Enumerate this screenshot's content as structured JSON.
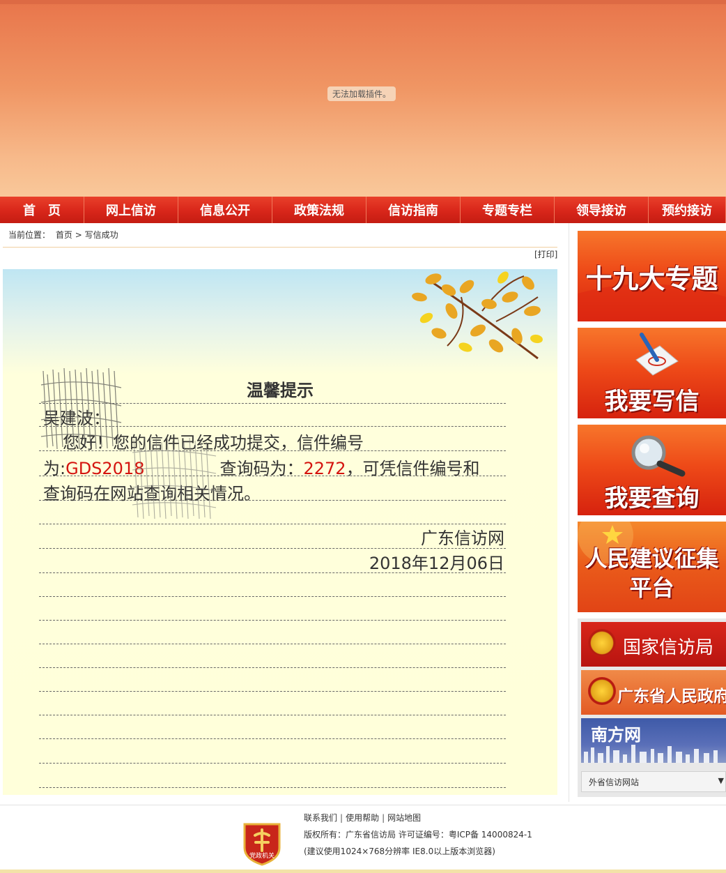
{
  "banner": {
    "plugin_message": "无法加载插件。"
  },
  "nav": [
    {
      "label": "首　页",
      "w": 121
    },
    {
      "label": "网上信访",
      "w": 135
    },
    {
      "label": "信息公开",
      "w": 135
    },
    {
      "label": "政策法规",
      "w": 135
    },
    {
      "label": "信访指南",
      "w": 135
    },
    {
      "label": "专题专栏",
      "w": 135
    },
    {
      "label": "领导接访",
      "w": 135
    },
    {
      "label": "预约接访",
      "w": 111
    }
  ],
  "breadcrumb": {
    "prefix": "当前位置：",
    "home": "首页",
    "separator": ">",
    "current": "写信成功"
  },
  "print_label": "[打印]",
  "letter": {
    "title": "温馨提示",
    "name": "吴建波：",
    "line1": "您好！您的信件已经成功提交，信件编号",
    "line2_prefix": "为:",
    "letter_code": "GDS2018",
    "line2_middle": "查询码为：",
    "query_code": "2272",
    "line2_suffix": "，可凭信件编号和",
    "line3": "查询码在网站查询相关情况。",
    "signature": "广东信访网",
    "date": "2018年12月06日"
  },
  "sidebar": {
    "cards": [
      {
        "label": "十九大专题",
        "icon": "party-congress-icon"
      },
      {
        "label": "我要写信",
        "icon": "pen-letter-icon"
      },
      {
        "label": "我要查询",
        "icon": "magnifier-icon"
      },
      {
        "label_1": "人民建议征集",
        "label_2": "平台",
        "icon": "party-emblem-icon"
      }
    ],
    "links": [
      {
        "label": "国家信访局",
        "icon": "national-emblem-icon"
      },
      {
        "label": "广东省人民政府",
        "icon": "national-emblem-icon"
      },
      {
        "label": "南方网",
        "icon": "city-skyline-icon"
      }
    ],
    "select": {
      "selected": "外省信访网站"
    }
  },
  "footer": {
    "links": [
      "联系我们",
      "使用帮助",
      "网站地图"
    ],
    "copyright": "版权所有：广东省信访局 许可证编号：粤ICP备 14000824-1",
    "note": "(建议使用1024×768分辨率 IE8.0以上版本浏览器)",
    "badge_label": "党政机关"
  },
  "colors": {
    "nav_red": "#d8261a",
    "code_red": "#d4140f",
    "letter_bg": "#ffffda"
  }
}
